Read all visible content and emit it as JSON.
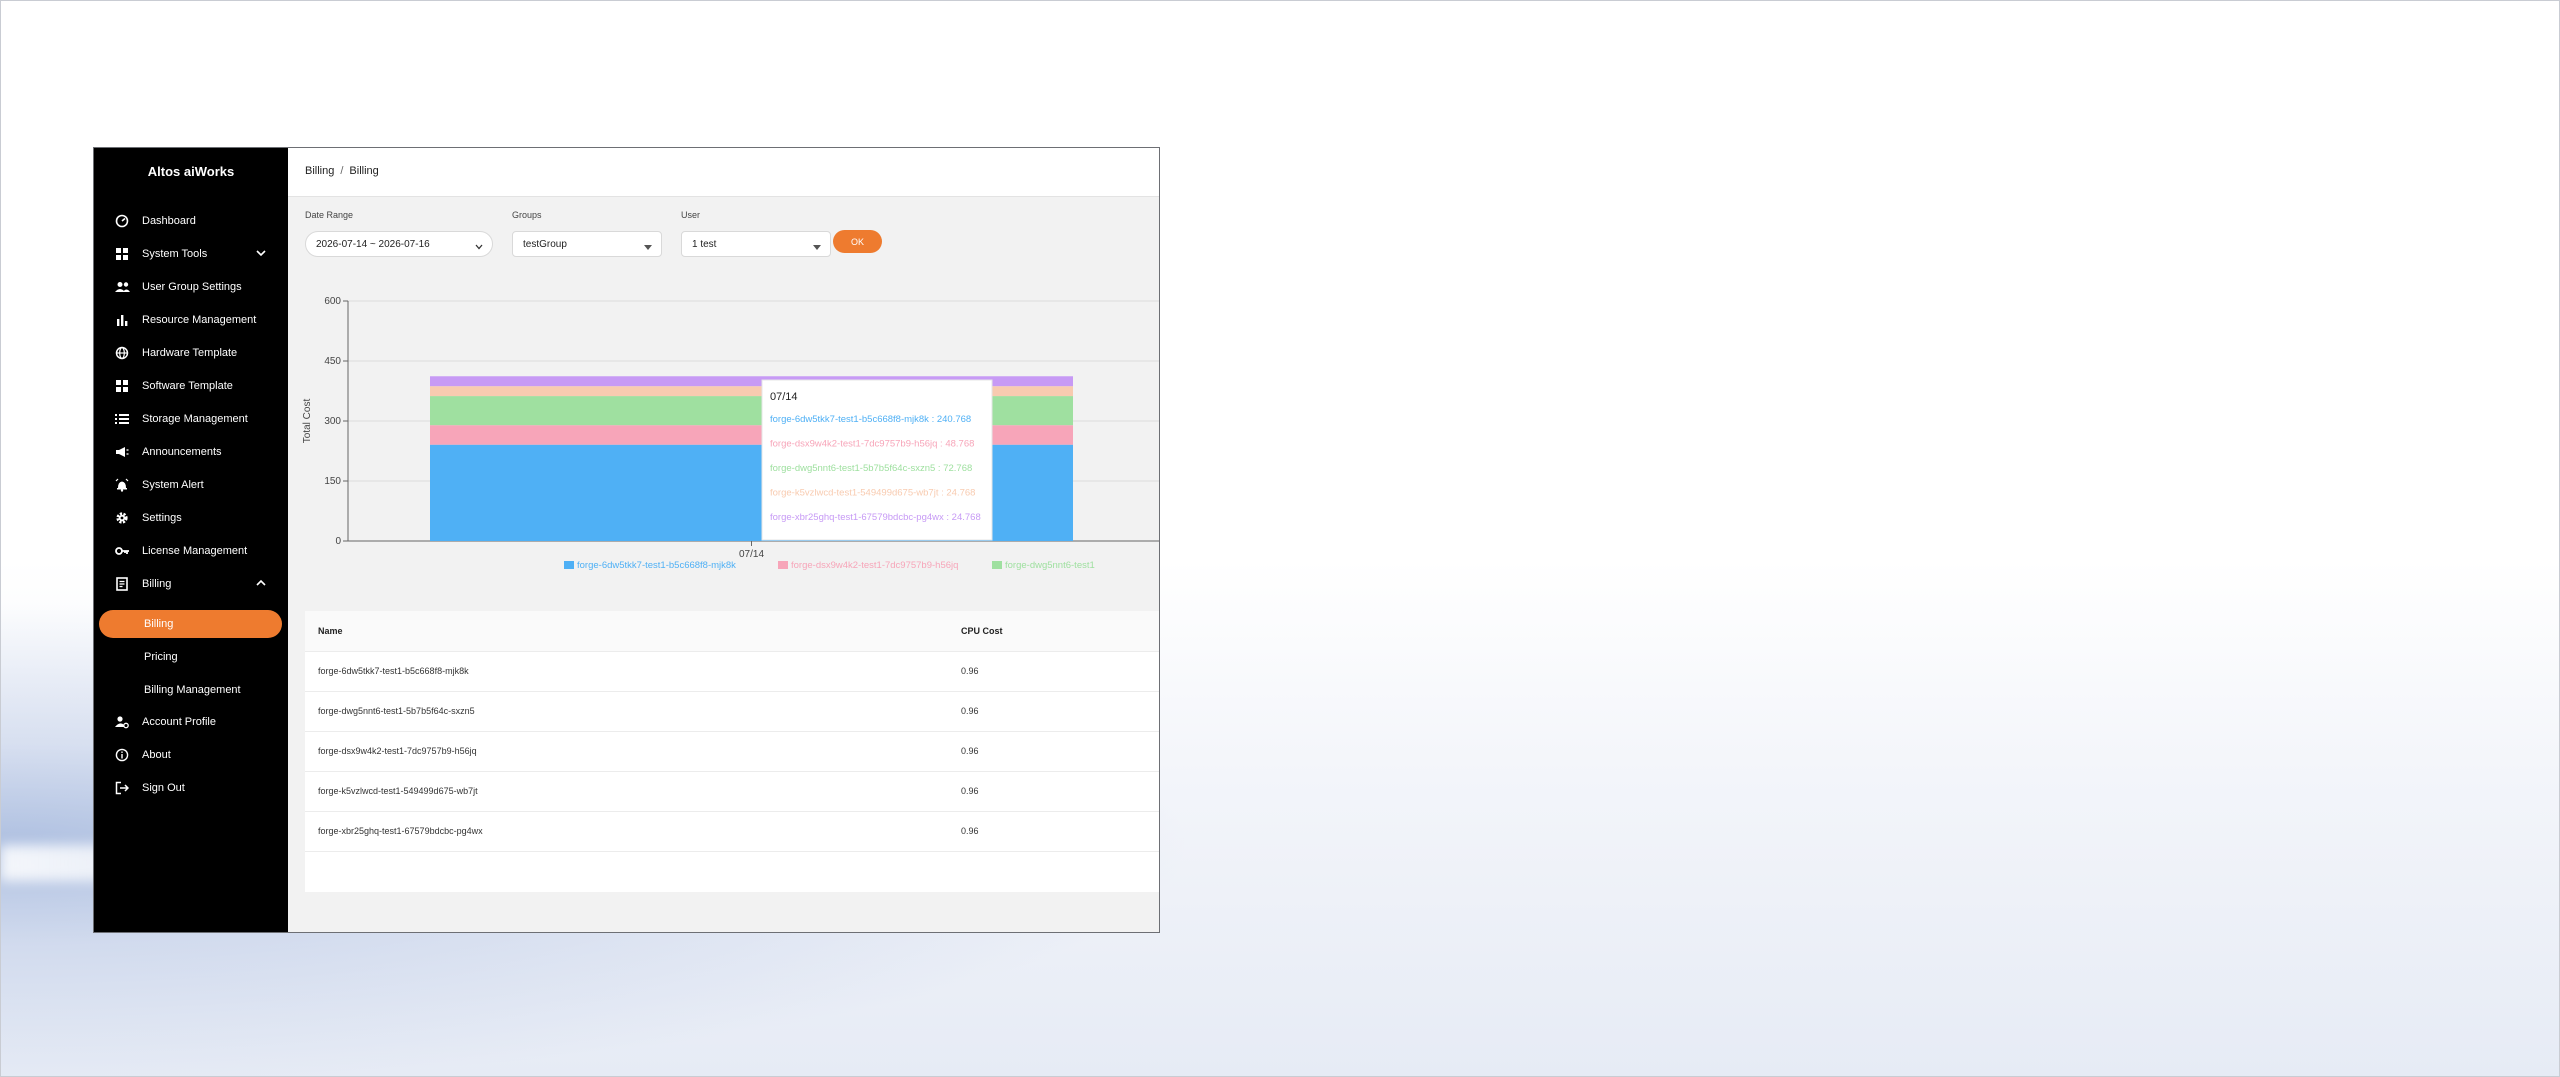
{
  "app": {
    "title": "Altos aiWorks"
  },
  "sidebar": {
    "items": [
      {
        "label": "Dashboard"
      },
      {
        "label": "System Tools"
      },
      {
        "label": "User Group Settings"
      },
      {
        "label": "Resource Management"
      },
      {
        "label": "Hardware Template"
      },
      {
        "label": "Software Template"
      },
      {
        "label": "Storage Management"
      },
      {
        "label": "Announcements"
      },
      {
        "label": "System Alert"
      },
      {
        "label": "Settings"
      },
      {
        "label": "License Management"
      },
      {
        "label": "Billing"
      }
    ],
    "billing_sub": [
      {
        "label": "Billing"
      },
      {
        "label": "Pricing"
      },
      {
        "label": "Billing Management"
      }
    ],
    "bottom": [
      {
        "label": "Account Profile"
      },
      {
        "label": "About"
      },
      {
        "label": "Sign Out"
      }
    ],
    "accent_color": "#ee7b2f"
  },
  "breadcrumb": {
    "parent": "Billing",
    "separator": "/",
    "current": "Billing"
  },
  "filters": {
    "date_range": {
      "label": "Date Range",
      "value": "2026-07-14 ~ 2026-07-16"
    },
    "groups": {
      "label": "Groups",
      "value": "testGroup"
    },
    "user": {
      "label": "User",
      "value": "1 test"
    },
    "ok_label": "OK"
  },
  "chart_data": {
    "type": "bar",
    "stacked": true,
    "categories": [
      "07/14"
    ],
    "ylabel": "Total Cost",
    "xlabel": "",
    "ylim": [
      0,
      600
    ],
    "yticks": [
      0,
      150,
      300,
      450,
      600
    ],
    "grid": true,
    "legend_position": "bottom",
    "series": [
      {
        "name": "forge-6dw5tkk7-test1-b5c668f8-mjk8k",
        "values": [
          240.768
        ],
        "color": "#4fb0f5"
      },
      {
        "name": "forge-dsx9w4k2-test1-7dc9757b9-h56jq",
        "values": [
          48.768
        ],
        "color": "#f7a5b9"
      },
      {
        "name": "forge-dwg5nnt6-test1-5b7b5f64c-sxzn5",
        "values": [
          72.768
        ],
        "color": "#9fe0a0"
      },
      {
        "name": "forge-k5vzlwcd-test1-549499d675-wb7jt",
        "values": [
          24.768
        ],
        "color": "#f8cbb0"
      },
      {
        "name": "forge-xbr25ghq-test1-67579bdcbc-pg4wx",
        "values": [
          24.768
        ],
        "color": "#c79af5"
      }
    ],
    "tooltip": {
      "title": "07/14",
      "lines": [
        "forge-6dw5tkk7-test1-b5c668f8-mjk8k : 240.768",
        "forge-dsx9w4k2-test1-7dc9757b9-h56jq : 48.768",
        "forge-dwg5nnt6-test1-5b7b5f64c-sxzn5 : 72.768",
        "forge-k5vzlwcd-test1-549499d675-wb7jt : 24.768",
        "forge-xbr25ghq-test1-67579bdcbc-pg4wx : 24.768"
      ]
    },
    "legend_visible": [
      "forge-6dw5tkk7-test1-b5c668f8-mjk8k",
      "forge-dsx9w4k2-test1-7dc9757b9-h56jq",
      "forge-dwg5nnt6-test1"
    ]
  },
  "table": {
    "columns": [
      "Name",
      "CPU Cost"
    ],
    "rows": [
      [
        "forge-6dw5tkk7-test1-b5c668f8-mjk8k",
        "0.96"
      ],
      [
        "forge-dwg5nnt6-test1-5b7b5f64c-sxzn5",
        "0.96"
      ],
      [
        "forge-dsx9w4k2-test1-7dc9757b9-h56jq",
        "0.96"
      ],
      [
        "forge-k5vzlwcd-test1-549499d675-wb7jt",
        "0.96"
      ],
      [
        "forge-xbr25ghq-test1-67579bdcbc-pg4wx",
        "0.96"
      ]
    ]
  }
}
